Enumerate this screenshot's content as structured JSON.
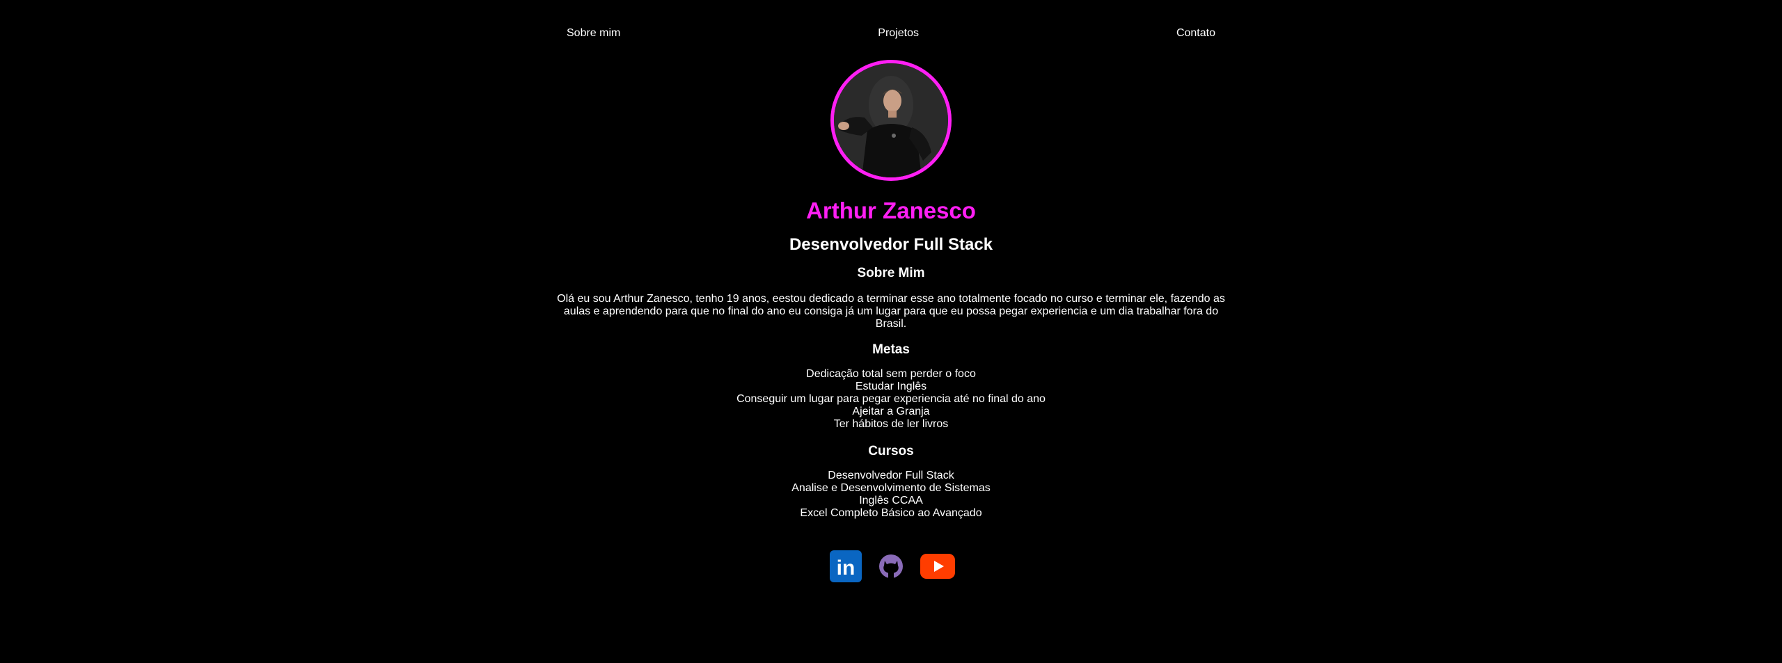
{
  "nav": {
    "items": [
      {
        "label": "Sobre mim"
      },
      {
        "label": "Projetos"
      },
      {
        "label": "Contato"
      }
    ]
  },
  "profile": {
    "name": "Arthur Zanesco",
    "role": "Desenvolvedor Full Stack",
    "accent_color": "#ff1ff4"
  },
  "about": {
    "title": "Sobre Mim",
    "text": "Olá eu sou Arthur Zanesco, tenho 19 anos, eestou dedicado a terminar esse ano totalmente focado no curso e terminar ele, fazendo as aulas e aprendendo para que no final do ano eu consiga já um lugar para que eu possa pegar experiencia e um dia trabalhar fora do Brasil."
  },
  "goals": {
    "title": "Metas",
    "items": [
      "Dedicação total sem perder o foco",
      "Estudar Inglês",
      "Conseguir um lugar para pegar experiencia até no final do ano",
      "Ajeitar a Granja",
      "Ter hábitos de ler livros"
    ]
  },
  "courses": {
    "title": "Cursos",
    "items": [
      "Desenvolvedor Full Stack",
      "Analise e Desenvolvimento de Sistemas",
      "Inglês CCAA",
      "Excel Completo Básico ao Avançado"
    ]
  },
  "social": {
    "items": [
      {
        "icon": "linkedin-icon",
        "color": "#0a66c2",
        "text": "in"
      },
      {
        "icon": "github-icon",
        "color": "#8a6bb8"
      },
      {
        "icon": "youtube-icon",
        "color": "#ff3d00"
      }
    ]
  }
}
